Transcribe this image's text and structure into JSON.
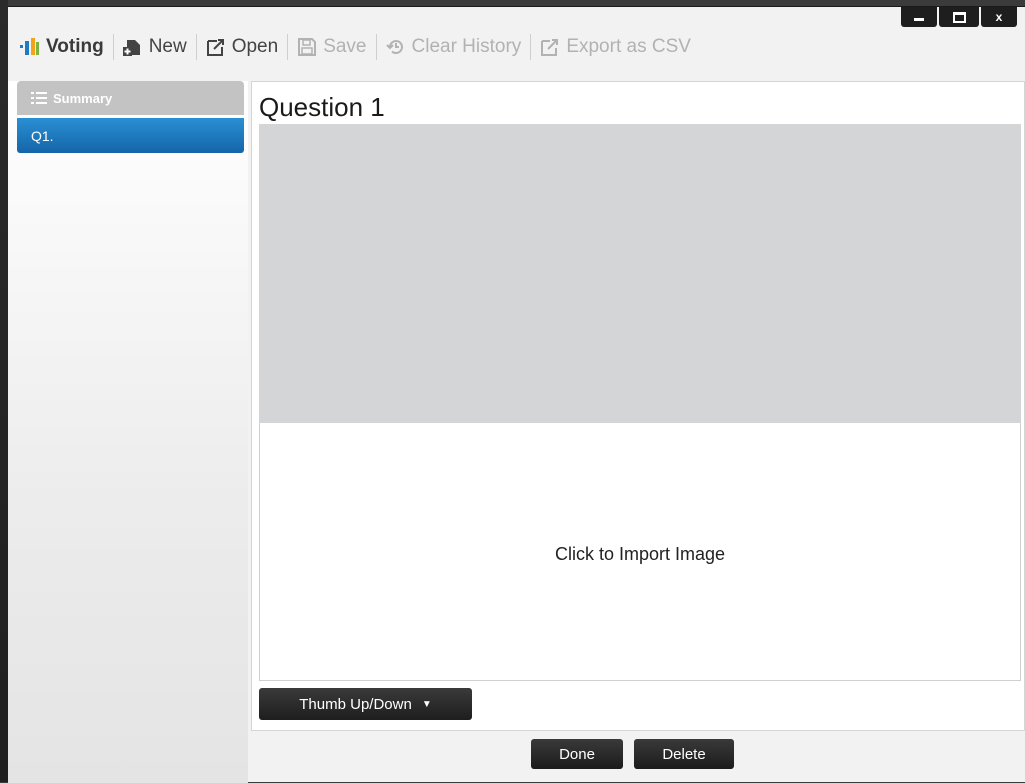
{
  "window": {
    "controls": [
      "minimize",
      "maximize",
      "close"
    ],
    "close_glyph": "x"
  },
  "toolbar": {
    "app_label": "Voting",
    "new_label": "New",
    "open_label": "Open",
    "save_label": "Save",
    "clear_history_label": "Clear History",
    "export_label": "Export as CSV",
    "disabled_items": [
      "Save",
      "Clear History",
      "Export as CSV"
    ]
  },
  "sidebar": {
    "items": [
      {
        "label": "Summary",
        "icon": "list-icon",
        "selected": false
      },
      {
        "label": "Q1.",
        "icon": "",
        "selected": true
      }
    ]
  },
  "question": {
    "title": "Question 1",
    "import_text": "Click to Import Image",
    "type_label": "Thumb Up/Down",
    "type_caret": "▼"
  },
  "footer": {
    "done_label": "Done",
    "delete_label": "Delete"
  },
  "colors": {
    "accent_blue": "#1f7bc0",
    "button_dark": "#262626",
    "image_placeholder": "#d4d5d7",
    "sidebar_summary": "#c3c3c3"
  }
}
